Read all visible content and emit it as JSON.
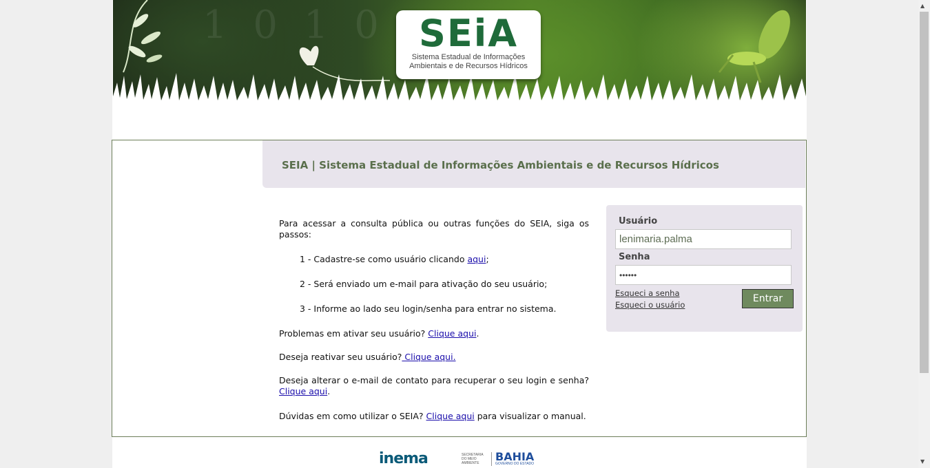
{
  "header": {
    "logo_text": "SEiA",
    "logo_subtitle_line1": "Sistema Estadual de Informações",
    "logo_subtitle_line2": "Ambientais e de Recursos Hídricos"
  },
  "main": {
    "title": "SEIA | Sistema Estadual de Informações Ambientais e de Recursos Hídricos",
    "intro": "Para acessar a consulta pública ou outras funções do SEIA, siga os passos:",
    "step1_text": "1 - Cadastre-se como usuário clicando ",
    "step1_link": "aqui",
    "step1_end": ";",
    "step2_text": "2 - Será enviado um e-mail para ativação do seu usuário;",
    "step3_text": "3 - Informe ao lado seu login/senha para entrar no sistema.",
    "problems_text": "Problemas em ativar seu usuário? ",
    "problems_link": "Clique aqui",
    "problems_end": ".",
    "reactivate_text": "Deseja reativar seu usuário?",
    "reactivate_link": " Clique aqui.",
    "email_text": "Deseja alterar o e-mail de contato para recuperar o seu login e senha? ",
    "email_link": "Clique aqui",
    "email_end": ".",
    "doubts_text": "Dúvidas em como utilizar o SEIA? ",
    "doubts_link": "Clique aqui",
    "doubts_end": " para visualizar o manual."
  },
  "login": {
    "user_label": "Usuário",
    "user_value": "lenimaria.palma",
    "password_label": "Senha",
    "password_value": "••••••",
    "forgot_password": "Esqueci a senha",
    "forgot_user": "Esqueci o usuário",
    "submit_label": "Entrar"
  },
  "footer": {
    "inema_logo": "inema",
    "secretaria_text": "SECRETARIA DO MEIO AMBIENTE",
    "bahia_logo": "BAHIA",
    "bahia_sub": "GOVERNO DO ESTADO"
  },
  "colors": {
    "accent_green": "#6f8a5e",
    "title_green": "#5a6f4c",
    "panel_bg": "#e8e4ec",
    "link": "#1a0dab"
  },
  "icons": [
    "butterfly-icon",
    "leaf-icon",
    "grasshopper-icon",
    "scroll-up-arrow-icon",
    "scroll-down-arrow-icon"
  ]
}
